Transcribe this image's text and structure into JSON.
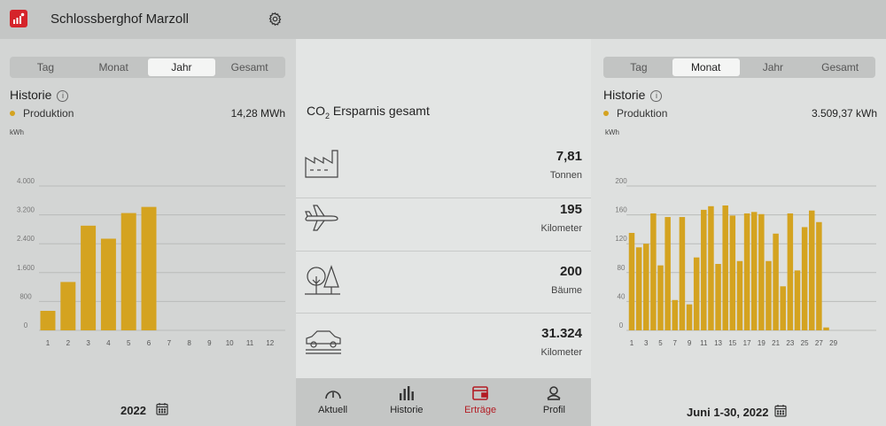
{
  "app": {
    "title": "Schlossberghof Marzoll",
    "logo_icon": "solar-app-logo-icon",
    "settings_icon": "gear-icon"
  },
  "left": {
    "tabs": [
      {
        "label": "Tag",
        "active": false
      },
      {
        "label": "Monat",
        "active": false
      },
      {
        "label": "Jahr",
        "active": true
      },
      {
        "label": "Gesamt",
        "active": false
      }
    ],
    "history_title": "Historie",
    "legend_label": "Produktion",
    "total": "14,28 MWh",
    "period": "2022"
  },
  "mid": {
    "title_prefix": "CO",
    "title_sub": "2",
    "title_suffix": " Ersparnis gesamt",
    "rows": [
      {
        "icon": "factory-icon",
        "value": "7,81",
        "unit": "Tonnen"
      },
      {
        "icon": "airplane-icon",
        "value": "195",
        "unit": "Kilometer"
      },
      {
        "icon": "trees-icon",
        "value": "200",
        "unit": "Bäume"
      },
      {
        "icon": "car-icon",
        "value": "31.324",
        "unit": "Kilometer"
      }
    ],
    "nav": [
      {
        "label": "Aktuell",
        "icon": "gauge-icon",
        "active": false
      },
      {
        "label": "Historie",
        "icon": "bar-chart-icon",
        "active": false
      },
      {
        "label": "Erträge",
        "icon": "wallet-icon",
        "active": true
      },
      {
        "label": "Profil",
        "icon": "profile-icon",
        "active": false
      }
    ]
  },
  "right": {
    "tabs": [
      {
        "label": "Tag",
        "active": false
      },
      {
        "label": "Monat",
        "active": true
      },
      {
        "label": "Jahr",
        "active": false
      },
      {
        "label": "Gesamt",
        "active": false
      }
    ],
    "history_title": "Historie",
    "legend_label": "Produktion",
    "total": "3.509,37 kWh",
    "period": "Juni 1-30, 2022"
  },
  "colors": {
    "bar": "#d4a320",
    "accent": "#b31c24",
    "grid": "#b9bbba"
  },
  "chart_data": [
    {
      "type": "bar",
      "title": "",
      "ylabel": "kWh",
      "xlabel": "",
      "ylim": [
        0,
        4000
      ],
      "yticks": [
        "0",
        "800",
        "1.600",
        "2.400",
        "3.200",
        "4.000"
      ],
      "categories": [
        "1",
        "2",
        "3",
        "4",
        "5",
        "6",
        "7",
        "8",
        "9",
        "10",
        "11",
        "12"
      ],
      "series": [
        {
          "name": "Produktion",
          "values": [
            540,
            1340,
            2900,
            2540,
            3250,
            3420,
            0,
            0,
            0,
            0,
            0,
            0
          ]
        }
      ]
    },
    {
      "type": "bar",
      "title": "",
      "ylabel": "kWh",
      "xlabel": "",
      "ylim": [
        0,
        200
      ],
      "yticks": [
        "0",
        "40",
        "80",
        "120",
        "160",
        "200"
      ],
      "xticks": [
        "1",
        "3",
        "5",
        "7",
        "9",
        "11",
        "13",
        "15",
        "17",
        "19",
        "21",
        "23",
        "25",
        "27",
        "29"
      ],
      "categories": [
        "1",
        "2",
        "3",
        "4",
        "5",
        "6",
        "7",
        "8",
        "9",
        "10",
        "11",
        "12",
        "13",
        "14",
        "15",
        "16",
        "17",
        "18",
        "19",
        "20",
        "21",
        "22",
        "23",
        "24",
        "25",
        "26",
        "27",
        "28",
        "29",
        "30"
      ],
      "series": [
        {
          "name": "Produktion",
          "values": [
            135,
            115,
            120,
            162,
            90,
            157,
            42,
            157,
            36,
            101,
            167,
            172,
            92,
            173,
            159,
            96,
            162,
            164,
            161,
            96,
            134,
            61,
            162,
            83,
            143,
            166,
            150,
            4,
            0,
            0
          ]
        }
      ]
    }
  ]
}
